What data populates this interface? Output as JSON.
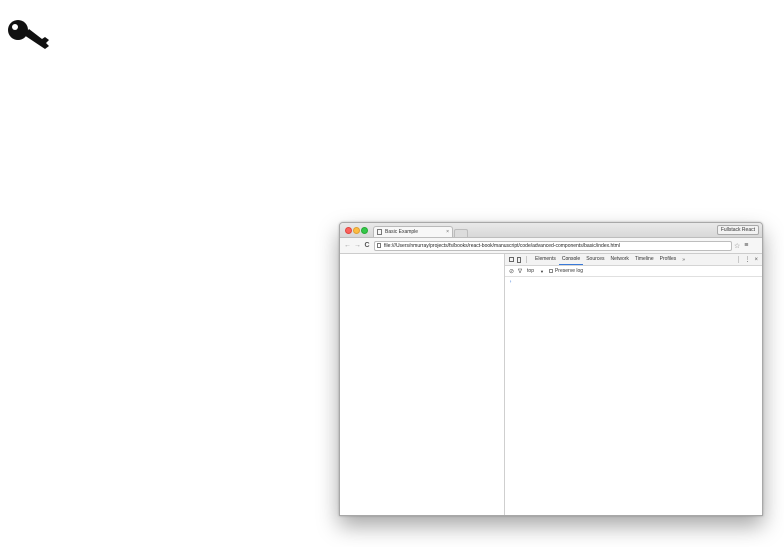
{
  "window": {
    "tab_title": "Basic Example",
    "tab_close": "×",
    "profile_button": "Fullstack React"
  },
  "toolbar": {
    "back": "←",
    "forward": "→",
    "reload": "C",
    "url": "file:///Users/nmurray/projects/fs/books/react-book/manuscript/code/advanced-components/basic/index.html",
    "star": "☆",
    "menu": "≡"
  },
  "devtools": {
    "tabs": [
      {
        "label": "Elements",
        "active": false
      },
      {
        "label": "Console",
        "active": true
      },
      {
        "label": "Sources",
        "active": false
      },
      {
        "label": "Network",
        "active": false
      },
      {
        "label": "Timeline",
        "active": false
      },
      {
        "label": "Profiles",
        "active": false
      }
    ],
    "more_tabs": "»",
    "menu": "⋮",
    "close": "×",
    "console": {
      "clear": "⃠",
      "filter": "∇",
      "context": "top",
      "context_caret": "▼",
      "preserve_log": "Preserve log",
      "prompt": "›"
    }
  },
  "colors": {
    "close": "#fc605c",
    "minimize": "#fdbc40",
    "maximize": "#34c84a",
    "active_tab_accent": "#3879d9"
  }
}
